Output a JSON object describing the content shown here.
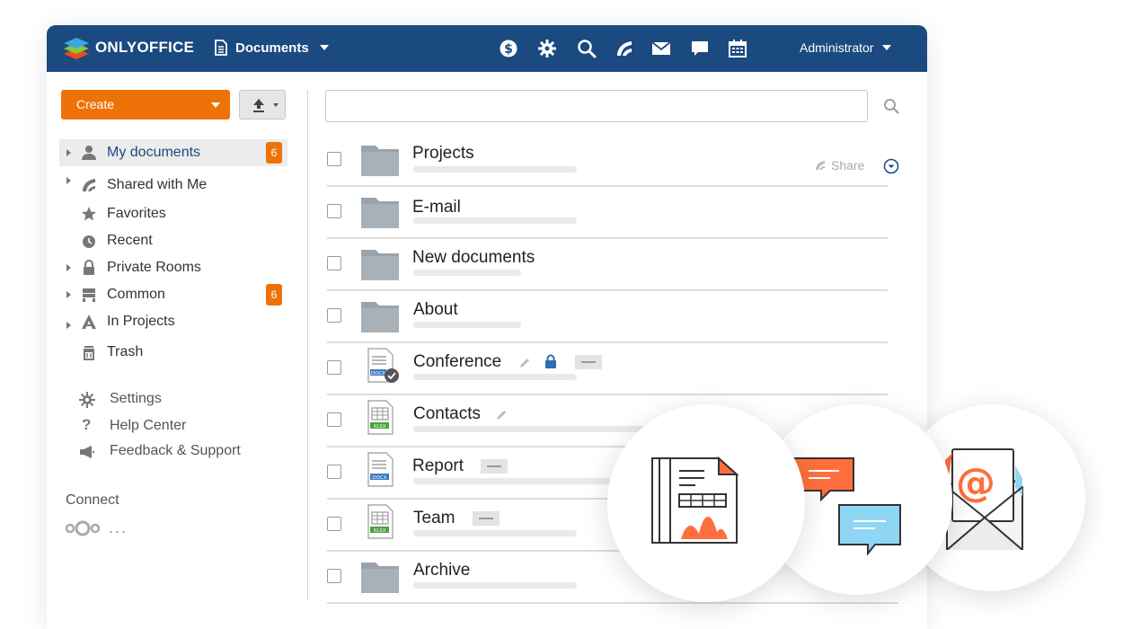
{
  "header": {
    "brand": "ONLYOFFICE",
    "module": "Documents",
    "user": "Administrator",
    "icons": [
      "payments-icon",
      "settings-icon",
      "search-icon",
      "feed-icon",
      "mail-icon",
      "chat-icon",
      "calendar-icon"
    ]
  },
  "sidebar": {
    "create_label": "Create",
    "items": [
      {
        "label": "My documents",
        "badge": "6"
      },
      {
        "label": "Shared with Me"
      },
      {
        "label": "Favorites"
      },
      {
        "label": "Recent"
      },
      {
        "label": "Private Rooms"
      },
      {
        "label": "Common",
        "badge": "6"
      },
      {
        "label": "In Projects"
      },
      {
        "label": "Trash"
      }
    ],
    "secondary": [
      {
        "label": "Settings"
      },
      {
        "label": "Help Center"
      },
      {
        "label": "Feedback & Support"
      }
    ],
    "connect_label": "Connect",
    "connect_more": "..."
  },
  "main": {
    "search": {
      "value": "",
      "placeholder": ""
    },
    "share_label": "Share",
    "files": [
      {
        "name": "Projects",
        "type": "folder"
      },
      {
        "name": "E-mail",
        "type": "folder"
      },
      {
        "name": "New documents",
        "type": "folder"
      },
      {
        "name": "About",
        "type": "folder"
      },
      {
        "name": "Conference",
        "type": "docx",
        "ext": "DOCX"
      },
      {
        "name": "Contacts",
        "type": "xlsx",
        "ext": "XLSX"
      },
      {
        "name": "Report",
        "type": "docx",
        "ext": "DOCX"
      },
      {
        "name": "Team",
        "type": "xlsx",
        "ext": "XLSX"
      },
      {
        "name": "Archive",
        "type": "folder"
      }
    ]
  },
  "colors": {
    "header": "#1b4a80",
    "accent": "#ed7309",
    "chat_orange": "#ff6f3d",
    "chat_blue": "#8fd6f4",
    "mail_at": "#ff6f3d"
  }
}
